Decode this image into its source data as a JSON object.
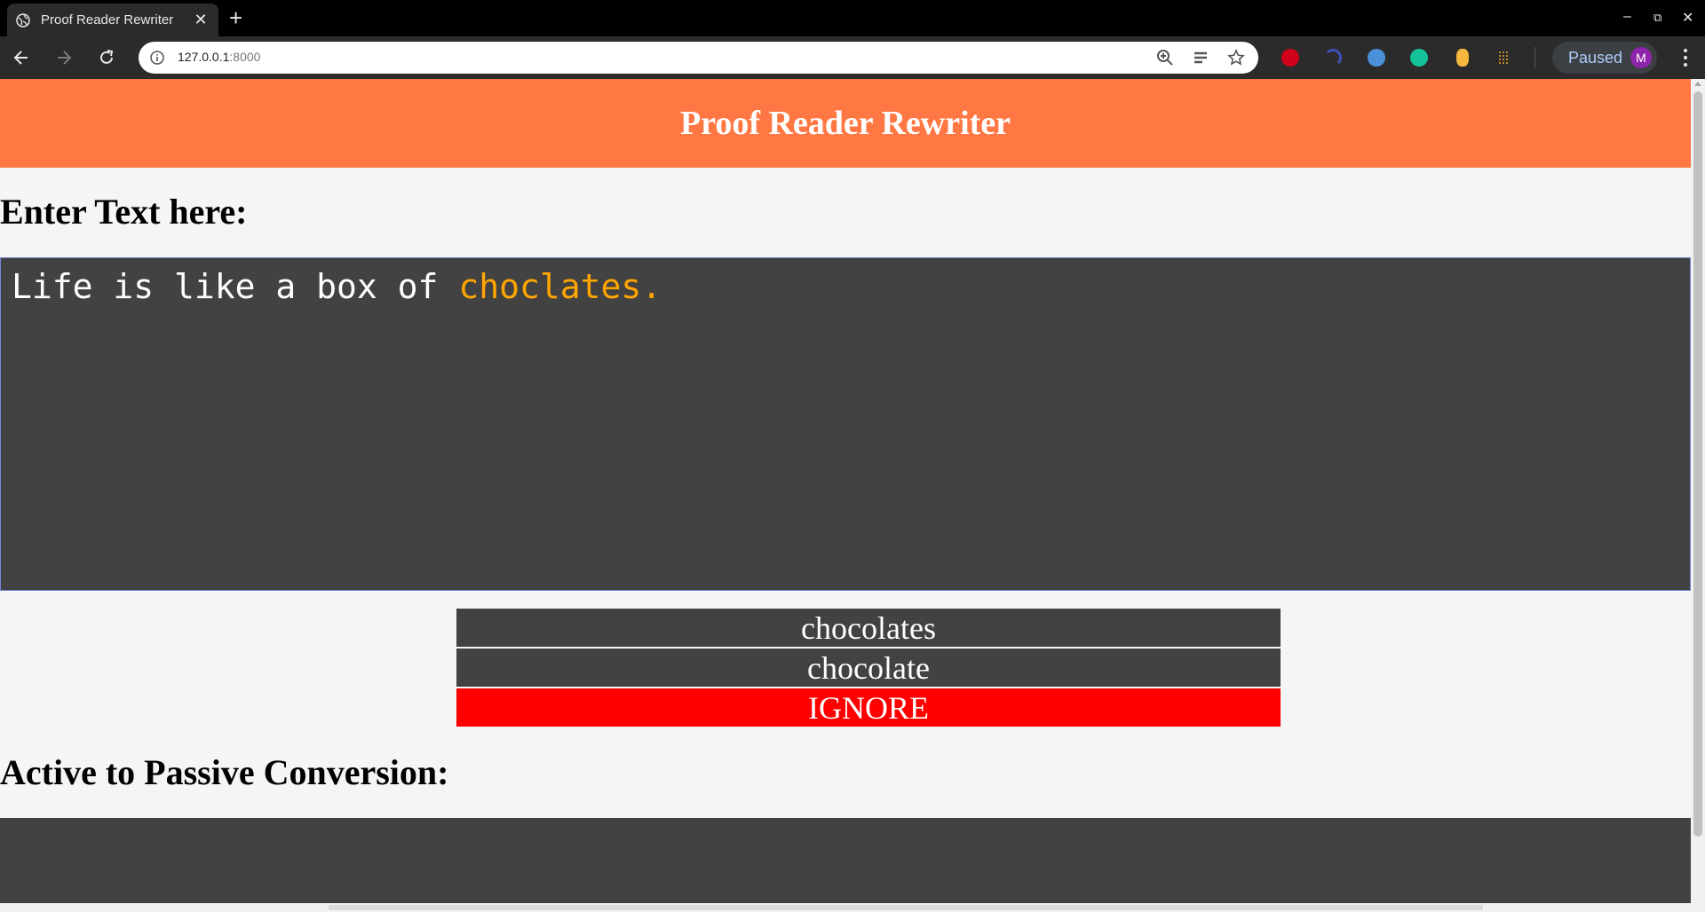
{
  "browser": {
    "tab_title": "Proof Reader Rewriter",
    "tab_close": "✕",
    "new_tab": "+",
    "url_host": "127.0.0.1",
    "url_port": ":8000",
    "profile_status": "Paused",
    "profile_initial": "M",
    "window_minimize": "–",
    "window_restore": "⧉",
    "window_close": "✕"
  },
  "page": {
    "title": "Proof Reader Rewriter",
    "input_label": "Enter Text here:",
    "input_text_plain": "Life is like a box of ",
    "input_text_error": "choclates.",
    "suggestions": [
      "chocolates",
      "chocolate"
    ],
    "ignore_label": "IGNORE",
    "passive_label": "Active to Passive Conversion:",
    "passive_text": ""
  },
  "colors": {
    "header_bg": "#ff7843",
    "editor_bg": "#424242",
    "error_text": "#ffa500",
    "ignore_bg": "#ff0000"
  }
}
